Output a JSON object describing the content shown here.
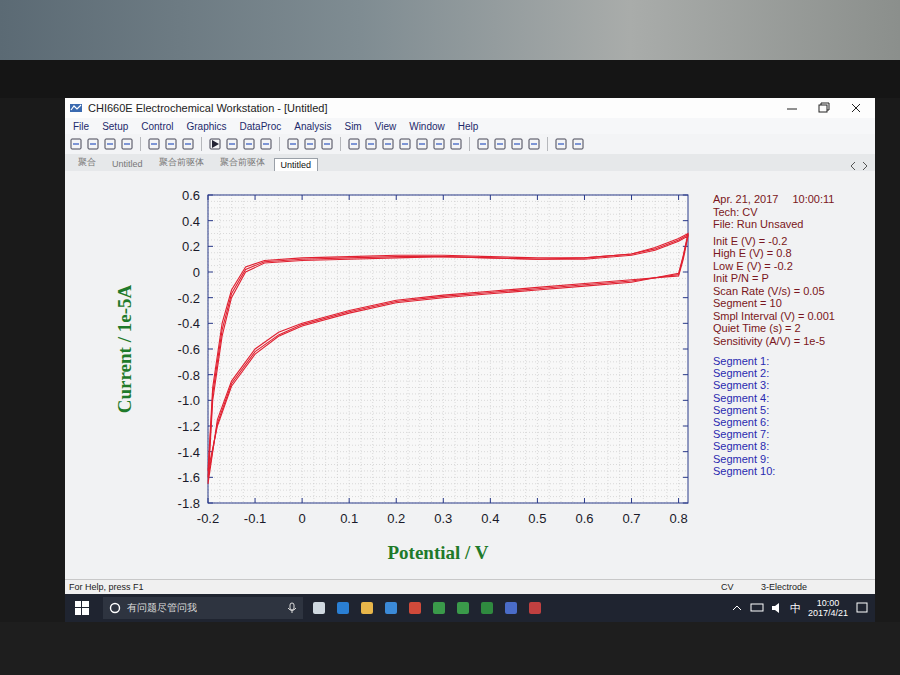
{
  "window": {
    "title": "CHI660E Electrochemical Workstation - [Untitled]"
  },
  "menu": [
    "File",
    "Setup",
    "Control",
    "Graphics",
    "DataProc",
    "Analysis",
    "Sim",
    "View",
    "Window",
    "Help"
  ],
  "tabs": [
    {
      "label": "聚合",
      "selected": false
    },
    {
      "label": "Untitled",
      "selected": false
    },
    {
      "label": "聚合前驱体",
      "selected": false
    },
    {
      "label": "聚合前驱体",
      "selected": false
    },
    {
      "label": "Untitled",
      "selected": true
    }
  ],
  "chart": {
    "y_axis": {
      "title": "Current / 1e-5A",
      "ticks": [
        "0.6",
        "0.4",
        "0.2",
        "0",
        "-0.2",
        "-0.4",
        "-0.6",
        "-0.8",
        "-1.0",
        "-1.2",
        "-1.4",
        "-1.6",
        "-1.8"
      ]
    },
    "x_axis": {
      "title": "Potential / V",
      "ticks": [
        "-0.2",
        "-0.1",
        "0",
        "0.1",
        "0.2",
        "0.3",
        "0.4",
        "0.5",
        "0.6",
        "0.7",
        "0.8"
      ]
    },
    "potential": [
      -0.2,
      -0.19,
      -0.17,
      -0.15,
      -0.12,
      -0.08,
      0,
      0.1,
      0.2,
      0.3,
      0.4,
      0.5,
      0.6,
      0.7,
      0.75,
      0.8,
      0.82,
      0.81,
      0.8,
      0.7,
      0.6,
      0.5,
      0.4,
      0.3,
      0.2,
      0.1,
      0,
      -0.05,
      -0.1,
      -0.15,
      -0.18,
      -0.2
    ],
    "series": [
      {
        "color": "#e02030",
        "current": [
          -1.65,
          -1.0,
          -0.5,
          -0.2,
          0.0,
          0.07,
          0.09,
          0.1,
          0.11,
          0.12,
          0.11,
          0.1,
          0.1,
          0.13,
          0.17,
          0.24,
          0.28,
          0.1,
          -0.03,
          -0.06,
          -0.09,
          -0.12,
          -0.15,
          -0.18,
          -0.22,
          -0.3,
          -0.4,
          -0.47,
          -0.6,
          -0.85,
          -1.15,
          -1.65
        ]
      },
      {
        "color": "#e02030",
        "current": [
          -1.6,
          -0.95,
          -0.45,
          -0.17,
          0.02,
          0.08,
          0.1,
          0.11,
          0.12,
          0.12,
          0.11,
          0.1,
          0.11,
          0.14,
          0.18,
          0.25,
          0.29,
          0.12,
          -0.02,
          -0.07,
          -0.1,
          -0.13,
          -0.16,
          -0.19,
          -0.23,
          -0.31,
          -0.41,
          -0.49,
          -0.62,
          -0.87,
          -1.18,
          -1.6
        ]
      },
      {
        "color": "#e02030",
        "current": [
          -1.55,
          -0.9,
          -0.4,
          -0.14,
          0.04,
          0.09,
          0.11,
          0.12,
          0.13,
          0.13,
          0.12,
          0.11,
          0.11,
          0.14,
          0.19,
          0.26,
          0.3,
          0.13,
          -0.01,
          -0.08,
          -0.11,
          -0.14,
          -0.17,
          -0.2,
          -0.24,
          -0.32,
          -0.42,
          -0.5,
          -0.64,
          -0.89,
          -1.2,
          -1.55
        ]
      }
    ]
  },
  "info": {
    "date": "Apr. 21, 2017",
    "time": "10:00:11",
    "params": [
      "Tech: CV",
      "File: Run Unsaved",
      "Init E (V) = -0.2",
      "High E (V) = 0.8",
      "Low E (V) = -0.2",
      "Init P/N = P",
      "Scan Rate (V/s) = 0.05",
      "Segment = 10",
      "Smpl Interval (V) = 0.001",
      "Quiet Time (s) = 2",
      "Sensitivity (A/V) = 1e-5"
    ],
    "segments": [
      "Segment 1:",
      "Segment 2:",
      "Segment 3:",
      "Segment 4:",
      "Segment 5:",
      "Segment 6:",
      "Segment 7:",
      "Segment 8:",
      "Segment 9:",
      "Segment 10:"
    ]
  },
  "status_bar": {
    "help": "For Help, press F1",
    "technique": "CV",
    "electrode": "3-Electrode"
  },
  "taskbar": {
    "search_placeholder": "有问题尽管问我",
    "ime": "中",
    "time": "10:00",
    "date": "2017/4/21"
  }
}
